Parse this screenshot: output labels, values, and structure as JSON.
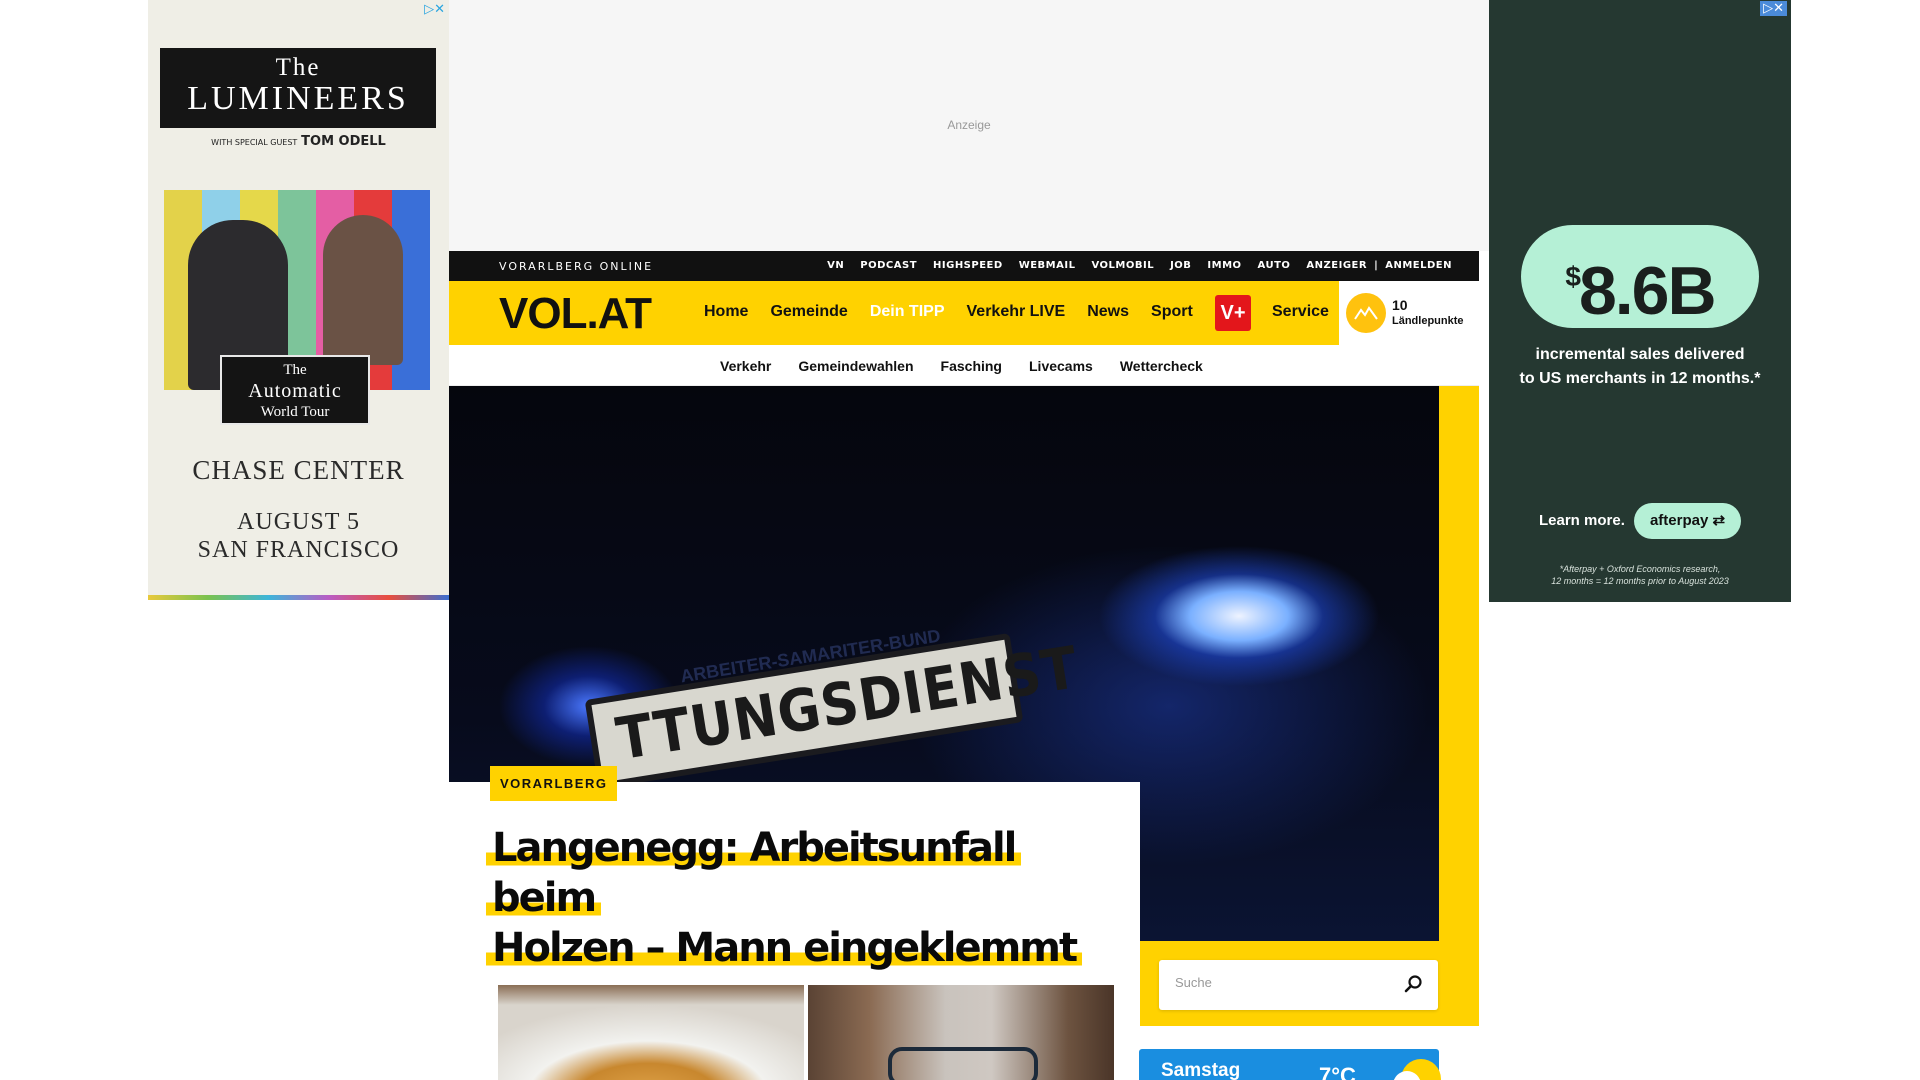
{
  "ad_left": {
    "adchoices": "▷✕",
    "the": "The",
    "band": "LUMINEERS",
    "guest_prefix": "WITH SPECIAL GUEST",
    "guest_name": "TOM ODELL",
    "tour_line1": "The",
    "tour_line2": "Automatic",
    "tour_line3": "World Tour",
    "venue": "CHASE CENTER",
    "date_line1": "AUGUST 5",
    "date_line2": "SAN FRANCISCO",
    "bar_colors": [
      "#e3d24a",
      "#8fd0e9",
      "#e5d84a",
      "#7dc49a",
      "#e45ea4",
      "#e43b3b",
      "#3a6fd8"
    ]
  },
  "ad_right": {
    "adchoices": "▷✕",
    "currency": "$",
    "amount": "8.6B",
    "sub_line1": "incremental sales delivered",
    "sub_line2": "to US merchants in 12 months.*",
    "learn_more": "Learn more.",
    "cta": "afterpay ⇄",
    "fine1": "*Afterpay + Oxford Economics research,",
    "fine2": "12 months = 12 months prior to August 2023"
  },
  "top_ad": {
    "label": "Anzeige"
  },
  "topbar": {
    "brand": "VORARLBERG ONLINE",
    "links": [
      "VN",
      "PODCAST",
      "HIGHSPEED",
      "WEBMAIL",
      "VOLMOBIL",
      "JOB",
      "IMMO",
      "AUTO",
      "ANZEIGER",
      "|",
      "ANMELDEN"
    ]
  },
  "nav": {
    "logo": "VOL.AT",
    "items": [
      "Home",
      "Gemeinde",
      "Dein TIPP",
      "Verkehr LIVE",
      "News",
      "Sport"
    ],
    "vplus": "V+",
    "service": "Service"
  },
  "points": {
    "value": "10",
    "label": "Ländlepunkte"
  },
  "subnav": {
    "items": [
      "Verkehr",
      "Gemeindewahlen",
      "Fasching",
      "Livecams",
      "Wettercheck"
    ]
  },
  "hero": {
    "sign_text": "TTUNGSDIENST",
    "sign_sub": "ARBEITER-SAMARITER-BUND"
  },
  "article": {
    "tag": "VORARLBERG",
    "headline_line1": "Langenegg: Arbeitsunfall beim",
    "headline_line2": "Holzen – Mann eingeklemmt"
  },
  "search": {
    "placeholder": "Suche"
  },
  "weather": {
    "day": "Samstag",
    "temp": "7°C"
  }
}
